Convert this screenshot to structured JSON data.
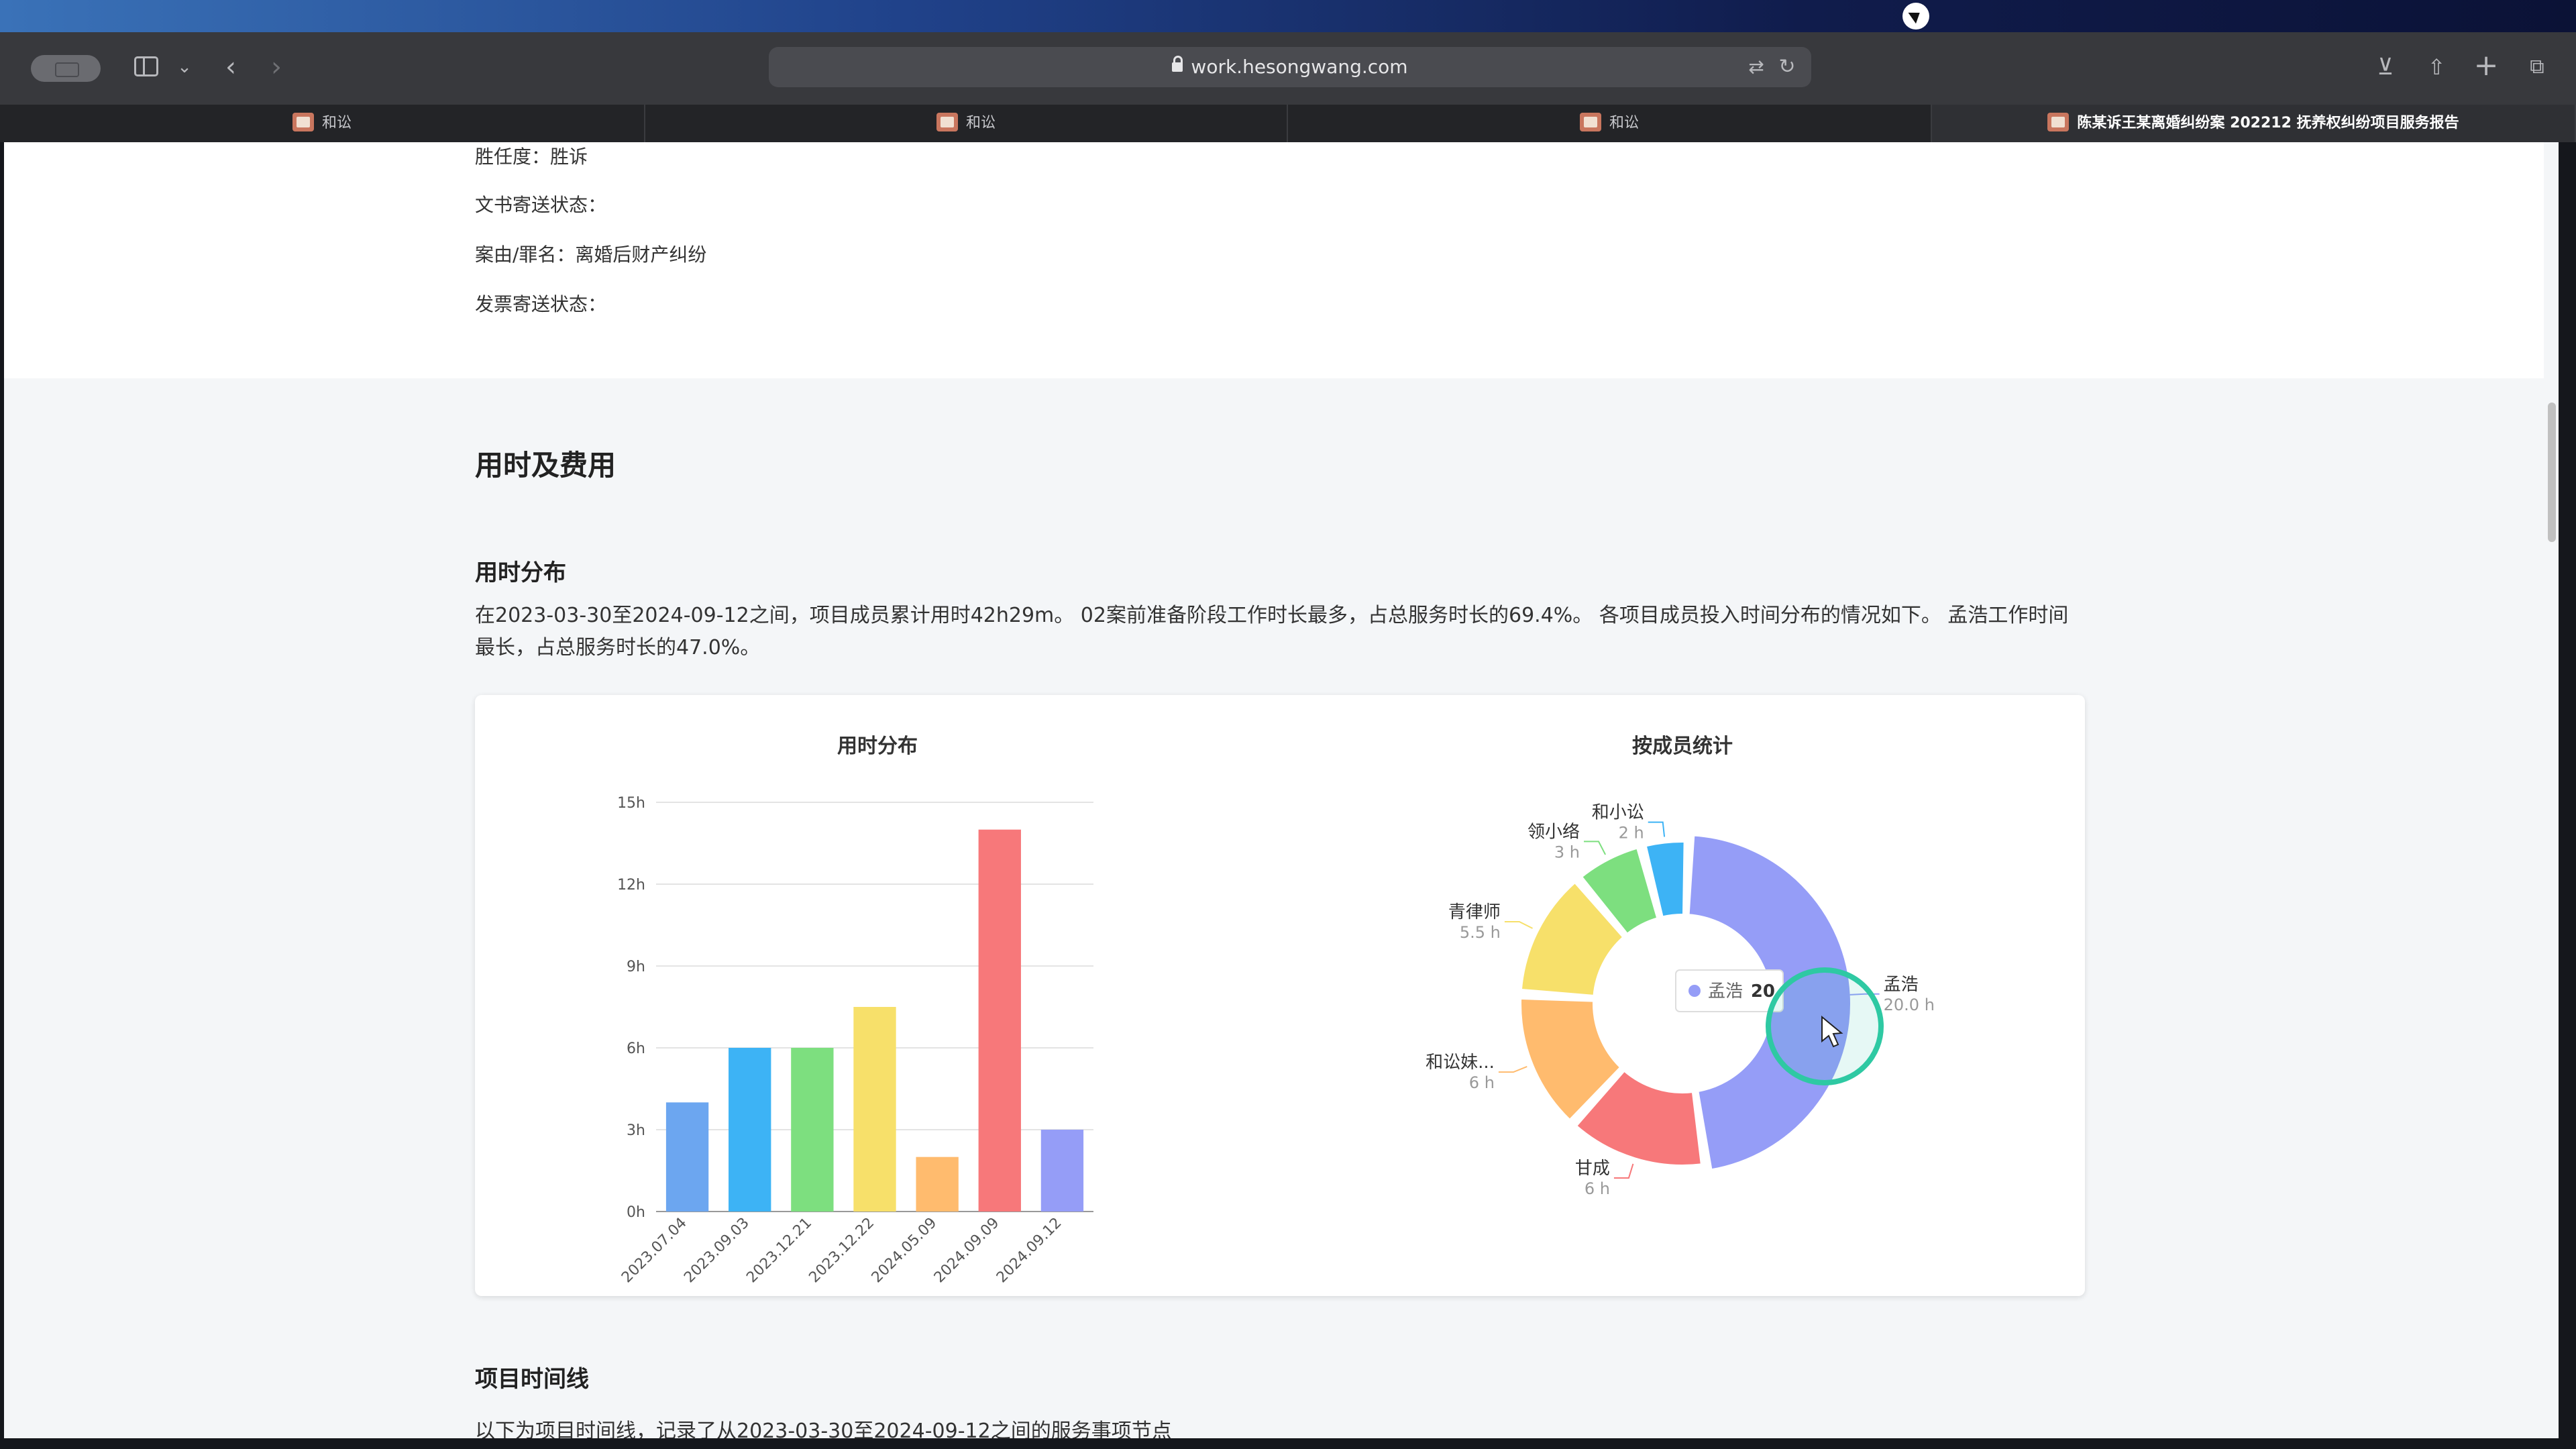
{
  "browser": {
    "url": "work.hesongwang.com",
    "tabs": [
      {
        "label": "和讼"
      },
      {
        "label": "和讼"
      },
      {
        "label": "和讼"
      },
      {
        "label": "陈某诉王某离婚纠纷案 202212 抚养权纠纷项目服务报告"
      }
    ]
  },
  "info": {
    "win_status": "胜任度：胜诉",
    "doc_mail_status": "文书寄送状态：",
    "cause": "案由/罪名：离婚后财产纠纷",
    "invoice_status": "发票寄送状态："
  },
  "section": {
    "title": "用时及费用",
    "subtitle": "用时分布",
    "description": "在2023-03-30至2024-09-12之间，项目成员累计用时42h29m。 02案前准备阶段工作时长最多，占总服务时长的69.4%。 各项目成员投入时间分布的情况如下。 孟浩工作时间最长，占总服务时长的47.0%。"
  },
  "timeline": {
    "title": "项目时间线",
    "description": "以下为项目时间线，记录了从2023-03-30至2024-09-12之间的服务事项节点"
  },
  "chart_data": [
    {
      "type": "bar",
      "title": "用时分布",
      "categories": [
        "2023.07.04",
        "2023.09.03",
        "2023.12.21",
        "2023.12.22",
        "2024.05.09",
        "2024.09.09",
        "2024.09.12"
      ],
      "values": [
        4,
        6,
        6,
        7.5,
        2,
        14,
        3
      ],
      "yticks": [
        "0h",
        "3h",
        "6h",
        "9h",
        "12h",
        "15h"
      ],
      "ylim": [
        0,
        15
      ],
      "colors": [
        "#6ca6f0",
        "#3db3f5",
        "#7ddf7f",
        "#f7e06a",
        "#ffbb6e",
        "#f7787a",
        "#959df7"
      ]
    },
    {
      "type": "pie",
      "title": "按成员统计",
      "slices": [
        {
          "name": "孟浩",
          "value": 20.0,
          "label": "20.0 h",
          "color": "#959df7"
        },
        {
          "name": "甘成",
          "value": 6,
          "label": "6 h",
          "color": "#f7787a"
        },
        {
          "name": "和讼妹...",
          "value": 6,
          "label": "6 h",
          "color": "#ffbb6e"
        },
        {
          "name": "青律师",
          "value": 5.5,
          "label": "5.5 h",
          "color": "#f7e06a"
        },
        {
          "name": "领小络",
          "value": 3,
          "label": "3 h",
          "color": "#7ddf7f"
        },
        {
          "name": "和小讼",
          "value": 2,
          "label": "2 h",
          "color": "#3db3f5"
        }
      ],
      "tooltip": {
        "name": "孟浩",
        "value": "20"
      }
    }
  ]
}
